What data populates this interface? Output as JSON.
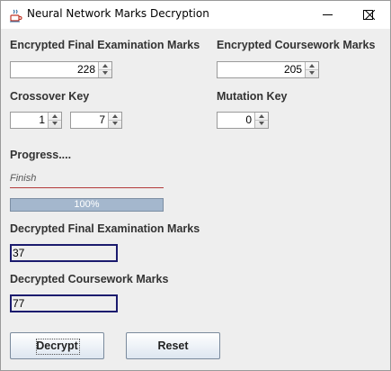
{
  "window": {
    "title": "Neural Network Marks Decryption"
  },
  "encrypted": {
    "final_label": "Encrypted Final Examination Marks",
    "final_value": "228",
    "coursework_label": "Encrypted Coursework Marks",
    "coursework_value": "205"
  },
  "crossover": {
    "label": "Crossover Key",
    "value1": "1",
    "value2": "7"
  },
  "mutation": {
    "label": "Mutation Key",
    "value": "0"
  },
  "progress": {
    "label": "Progress....",
    "status": "Finish",
    "percent": 100,
    "percent_text": "100%"
  },
  "decrypted": {
    "final_label": "Decrypted Final Examination Marks",
    "final_value": "37",
    "coursework_label": "Decrypted Coursework Marks",
    "coursework_value": "77"
  },
  "buttons": {
    "decrypt": "Decrypt",
    "reset": "Reset"
  },
  "colors": {
    "output_border": "#1b1b6e",
    "progress_bar": "#a9bbd0",
    "finish_line": "#b33a3a"
  }
}
